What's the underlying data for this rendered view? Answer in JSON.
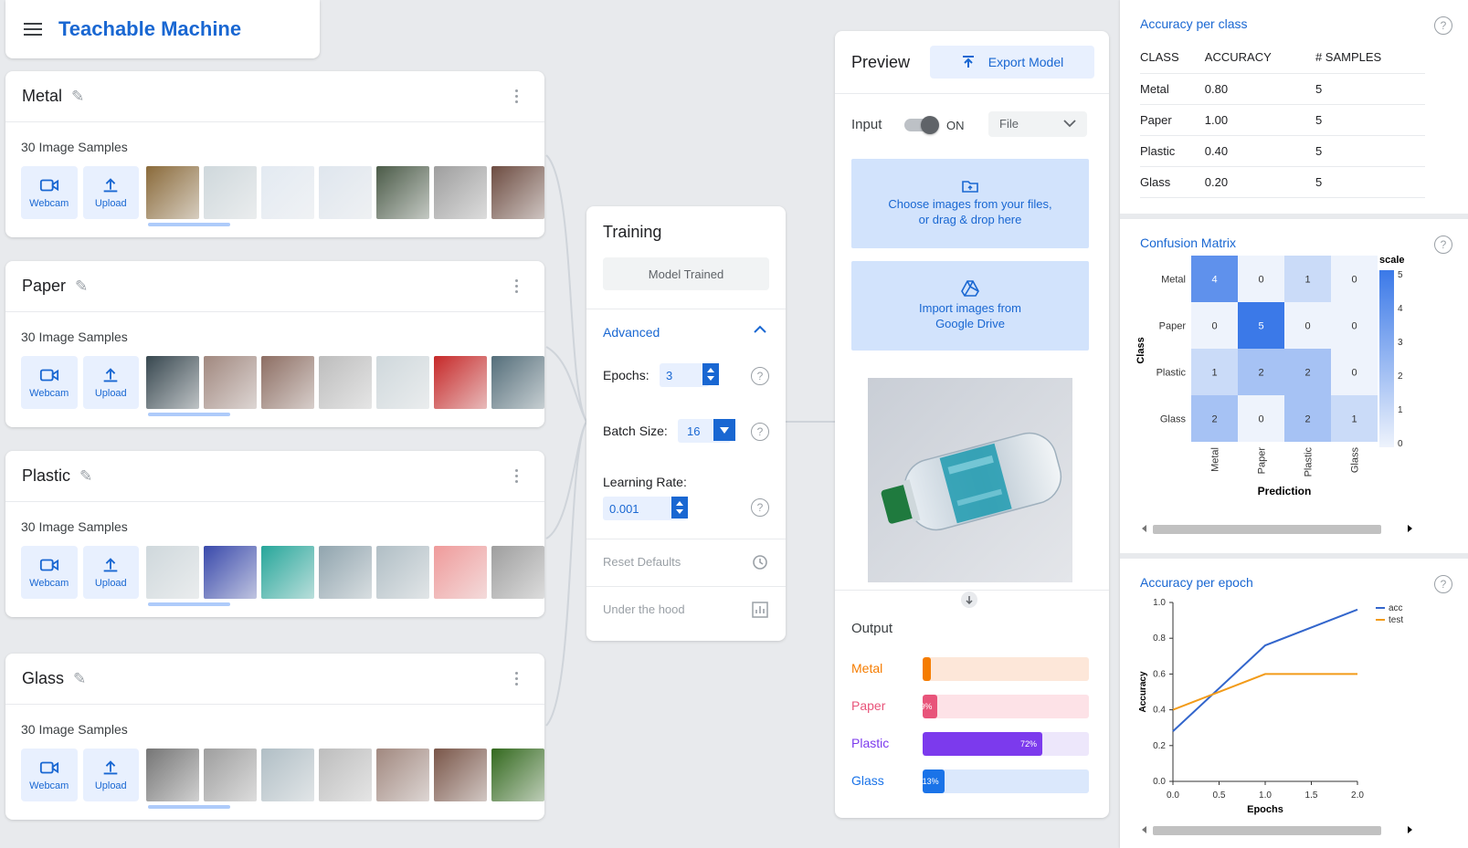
{
  "app": {
    "title": "Teachable Machine"
  },
  "classes": [
    {
      "name": "Metal",
      "samples_label": "30 Image Samples",
      "webcam_label": "Webcam",
      "upload_label": "Upload",
      "thumb_colors": [
        "#8a6a3a",
        "#cfd8dc",
        "#e3eaf2",
        "#dfe6ee",
        "#4b5b48",
        "#9e9e9e",
        "#6d4c41"
      ]
    },
    {
      "name": "Paper",
      "samples_label": "30 Image Samples",
      "webcam_label": "Webcam",
      "upload_label": "Upload",
      "thumb_colors": [
        "#37474f",
        "#a1887f",
        "#8d6e63",
        "#bdbdbd",
        "#cfd8dc",
        "#c62828",
        "#546e7a"
      ]
    },
    {
      "name": "Plastic",
      "samples_label": "30 Image Samples",
      "webcam_label": "Webcam",
      "upload_label": "Upload",
      "thumb_colors": [
        "#cfd8dc",
        "#3949ab",
        "#26a69a",
        "#90a4ae",
        "#b0bec5",
        "#ef9a9a",
        "#9e9e9e"
      ]
    },
    {
      "name": "Glass",
      "samples_label": "30 Image Samples",
      "webcam_label": "Webcam",
      "upload_label": "Upload",
      "thumb_colors": [
        "#757575",
        "#9e9e9e",
        "#b0bec5",
        "#bdbdbd",
        "#a1887f",
        "#795548",
        "#33691e"
      ]
    }
  ],
  "training": {
    "title": "Training",
    "trained_label": "Model Trained",
    "advanced_label": "Advanced",
    "epochs_label": "Epochs:",
    "epochs_value": "3",
    "batch_label": "Batch Size:",
    "batch_value": "16",
    "lr_label": "Learning Rate:",
    "lr_value": "0.001",
    "reset_label": "Reset Defaults",
    "hood_label": "Under the hood",
    "help_glyph": "?"
  },
  "preview": {
    "title": "Preview",
    "export_label": "Export Model",
    "input_label": "Input",
    "toggle_state": "ON",
    "source_value": "File",
    "drop_text_1": "Choose images from your files,",
    "drop_text_2": "or drag & drop here",
    "drive_text_1": "Import images from",
    "drive_text_2": "Google Drive",
    "output_title": "Output",
    "outputs": [
      {
        "label": "Metal",
        "percent": 5,
        "value_text": "",
        "color": "#f57c00",
        "track": "#fde7d9",
        "text_color": "#f57c00"
      },
      {
        "label": "Paper",
        "percent": 9,
        "value_text": "9%",
        "color": "#e8547a",
        "track": "#fde2e7",
        "text_color": "#e8547a"
      },
      {
        "label": "Plastic",
        "percent": 72,
        "value_text": "72%",
        "color": "#7c3aed",
        "track": "#ede7fb",
        "text_color": "#7c3aed"
      },
      {
        "label": "Glass",
        "percent": 13,
        "value_text": "13%",
        "color": "#1a73e8",
        "track": "#dbe8fc",
        "text_color": "#1a73e8"
      }
    ]
  },
  "accuracy_per_class": {
    "title": "Accuracy per class",
    "headers": [
      "CLASS",
      "ACCURACY",
      "# SAMPLES"
    ],
    "rows": [
      [
        "Metal",
        "0.80",
        "5"
      ],
      [
        "Paper",
        "1.00",
        "5"
      ],
      [
        "Plastic",
        "0.40",
        "5"
      ],
      [
        "Glass",
        "0.20",
        "5"
      ]
    ]
  },
  "confusion_matrix": {
    "title": "Confusion Matrix",
    "labels": [
      "Metal",
      "Paper",
      "Plastic",
      "Glass"
    ],
    "values": [
      [
        4,
        0,
        1,
        0
      ],
      [
        0,
        5,
        0,
        0
      ],
      [
        1,
        2,
        2,
        0
      ],
      [
        2,
        0,
        2,
        1
      ]
    ],
    "y_axis": "Class",
    "x_axis": "Prediction",
    "scale_title": "scale",
    "scale_ticks": [
      "5",
      "4",
      "3",
      "2",
      "1",
      "0"
    ]
  },
  "chart_data": {
    "type": "line",
    "title": "Accuracy per epoch",
    "xlabel": "Epochs",
    "ylabel": "Accuracy",
    "x": [
      0,
      1,
      2
    ],
    "xlim": [
      0,
      2
    ],
    "ylim": [
      0,
      1
    ],
    "x_ticks": [
      "0.0",
      "0.5",
      "1.0",
      "1.5",
      "2.0"
    ],
    "y_ticks": [
      "0.0",
      "0.2",
      "0.4",
      "0.6",
      "0.8",
      "1.0"
    ],
    "legend_position": "top-right",
    "series": [
      {
        "name": "acc",
        "color": "#3366cc",
        "values": [
          0.28,
          0.76,
          0.96
        ]
      },
      {
        "name": "test",
        "color": "#f29b19",
        "values": [
          0.4,
          0.6,
          0.6
        ]
      }
    ]
  }
}
